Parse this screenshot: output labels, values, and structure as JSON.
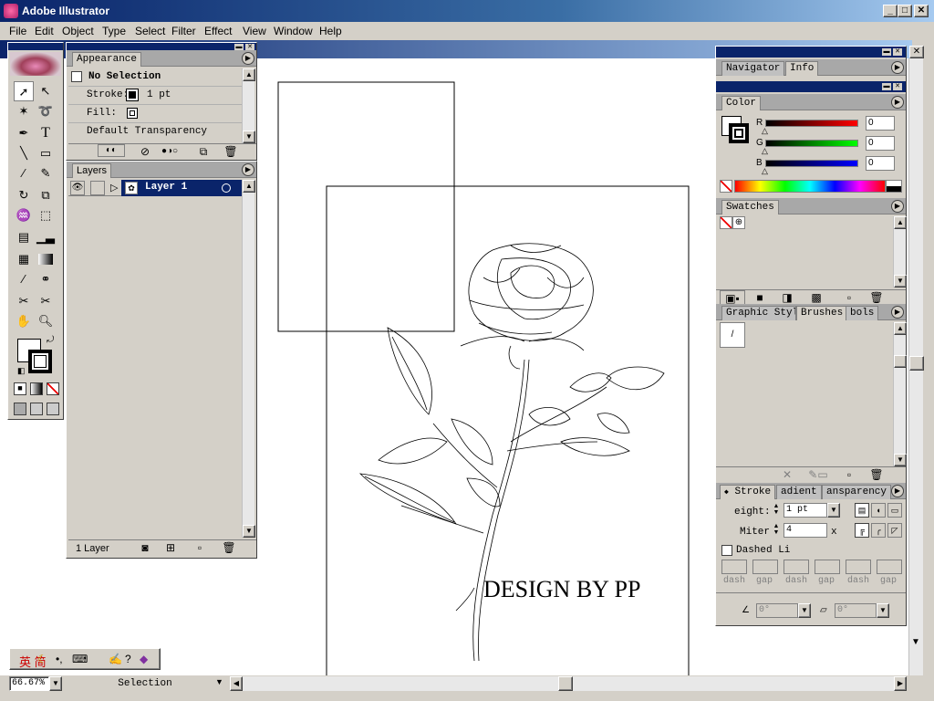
{
  "app": {
    "title": "Adobe Illustrator"
  },
  "menu": [
    "File",
    "Edit",
    "Object",
    "Type",
    "Select",
    "Filter",
    "Effect",
    "View",
    "Window",
    "Help"
  ],
  "appearance": {
    "tab": "Appearance",
    "no_selection": "No Selection",
    "stroke_label": "Stroke:",
    "stroke_value": "1 pt",
    "fill_label": "Fill:",
    "transparency": "Default Transparency"
  },
  "layers": {
    "tab": "Layers",
    "layer_name": "Layer 1",
    "footer": "1 Layer"
  },
  "navigator": {
    "tabs": [
      "Navigator",
      "Info"
    ]
  },
  "color": {
    "tab": "Color",
    "r_label": "R",
    "g_label": "G",
    "b_label": "B",
    "r": "0",
    "g": "0",
    "b": "0"
  },
  "swatches": {
    "tab": "Swatches"
  },
  "styles": {
    "tabs": [
      "Graphic Styl",
      "Brushes",
      "bols"
    ]
  },
  "stroke": {
    "tabs": [
      "Stroke",
      "adient",
      "ansparency"
    ],
    "weight_label": "eight:",
    "weight_value": "1 pt",
    "miter_label": "Miter",
    "miter_value": "4",
    "miter_unit": "x",
    "dashed_label": "Dashed Li",
    "dash_labels": [
      "dash",
      "gap",
      "dash",
      "gap",
      "dash",
      "gap"
    ],
    "angle1": "0°",
    "angle2": "0°"
  },
  "artwork": {
    "text": "DESIGN BY PP"
  },
  "status": {
    "zoom": "66.67%",
    "mode": "Selection"
  },
  "ime": {
    "chars": "英  简"
  }
}
